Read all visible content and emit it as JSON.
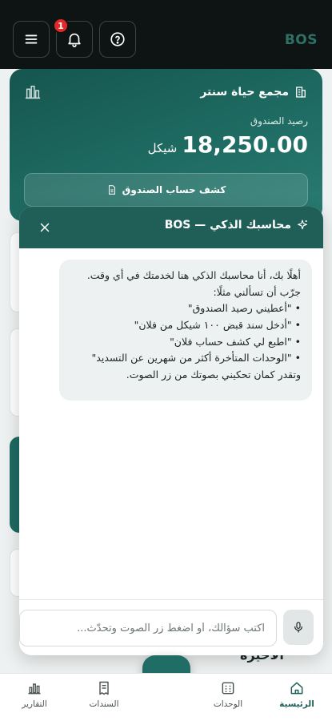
{
  "header": {
    "brand": "BOS",
    "notification_count": "1",
    "icons": [
      "menu-icon",
      "bell-icon",
      "help-icon"
    ]
  },
  "fund_card": {
    "complex_name": "مجمع حياة سنتر",
    "balance_label": "رصيد الصندوق",
    "balance_amount": "18,250.00",
    "currency": "شيكل",
    "statement_button": "كشف حساب الصندوق"
  },
  "background": {
    "peek_text": "الأخيرة"
  },
  "chat": {
    "title": "محاسبك الذكي — BOS",
    "greeting": "أهلًا بك، أنا محاسبك الذكي هنا لخدمتك في أي وقت.",
    "try_line": "جرّب أن تسألني مثلًا:",
    "examples": [
      "\"أعطيني رصيد الصندوق\"",
      "\"أدخل سند قبض ١٠٠ شيكل من فلان\"",
      "\"اطبع لي كشف حساب فلان\"",
      "\"الوحدات المتأخرة أكثر من شهرين عن التسديد\""
    ],
    "closing": "وتقدر كمان تحكيني بصوتك من زر الصوت.",
    "input_placeholder": "اكتب سؤالك، أو اضغط زر الصوت وتحدّث..."
  },
  "bottom_nav": {
    "home": "الرئيسية",
    "units": "الوحدات",
    "vouchers": "السندات",
    "reports": "التقارير",
    "active": "home"
  },
  "colors": {
    "primary": "#1f5f58",
    "topbar": "#0e1414",
    "badge": "#e02828"
  }
}
